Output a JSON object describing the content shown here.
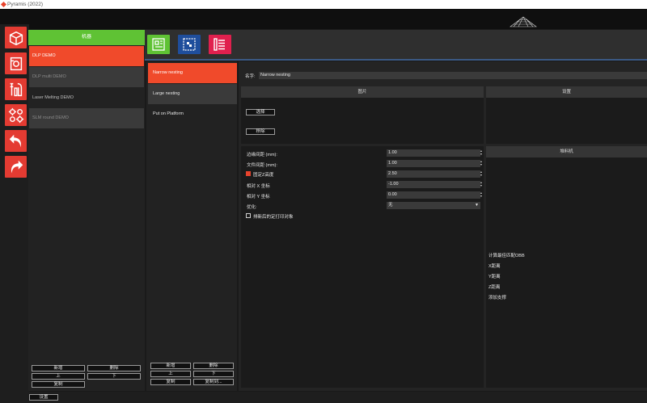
{
  "window": {
    "title": "Pyramis (2022)"
  },
  "toolbar": {
    "items": [
      {
        "name": "cube-tool",
        "icon": "cube-icon"
      },
      {
        "name": "part-tool",
        "icon": "part-icon"
      },
      {
        "name": "tools-tool",
        "icon": "wrench-screwdriver-icon"
      },
      {
        "name": "settings-tool",
        "icon": "gears-icon"
      },
      {
        "name": "undo-tool",
        "icon": "undo-icon"
      },
      {
        "name": "redo-tool",
        "icon": "redo-icon"
      }
    ]
  },
  "machine": {
    "header": "机器",
    "items": [
      "DLP DEMO",
      "DLP multi DEMO",
      "Laser Melting DEMO",
      "SLM round DEMO"
    ],
    "selected": 0,
    "buttons": {
      "add": "新增",
      "delete": "删除",
      "up": "上",
      "down": "下",
      "copy": "复制"
    }
  },
  "tabs": [
    {
      "name": "green-tab",
      "icon": "layout-icon",
      "color": "#5fc234"
    },
    {
      "name": "blue-tab",
      "icon": "nesting-icon",
      "color": "#1f4e9c"
    },
    {
      "name": "red-tab",
      "icon": "list-icon",
      "color": "#e0204e"
    }
  ],
  "nesting": {
    "items": [
      "Narrow nesting",
      "Large nesting",
      "Put on Platform"
    ],
    "selected": 0,
    "buttons": {
      "add": "新增",
      "delete": "删除",
      "up": "上",
      "down": "下",
      "copy": "复制",
      "copy_to": "复制到..."
    }
  },
  "detail": {
    "name_label": "名字:",
    "name_value": "Narrow nesting",
    "image_header": "图片",
    "settings_header": "设置",
    "select_button": "选择",
    "remove_button": "移除",
    "fields": [
      {
        "label": "边缘间距 (mm):",
        "value": "1.00",
        "checkbox": false
      },
      {
        "label": "文件间距 (mm):",
        "value": "1.00",
        "checkbox": false
      },
      {
        "label": "固定Z高度",
        "value": "2.50",
        "checkbox": true
      },
      {
        "label": "相对 X 坐标",
        "value": "-1.00",
        "checkbox": false
      },
      {
        "label": "相对 Y 坐标",
        "value": "0.00",
        "checkbox": false
      }
    ],
    "optimize_label": "优化:",
    "optimize_value": "无",
    "arrange_label": "排新后的定打印对象",
    "stacking_header": "堆料机",
    "stacking_items": [
      "计算最佳匹配OBB",
      "X距离",
      "Y距离",
      "Z距离",
      "添加支撑"
    ]
  },
  "bottom": {
    "settings_button": "设置"
  },
  "colors": {
    "accent_red": "#e8432c",
    "green": "#5fc234",
    "blue": "#1f4e9c",
    "magenta": "#e0204e"
  }
}
